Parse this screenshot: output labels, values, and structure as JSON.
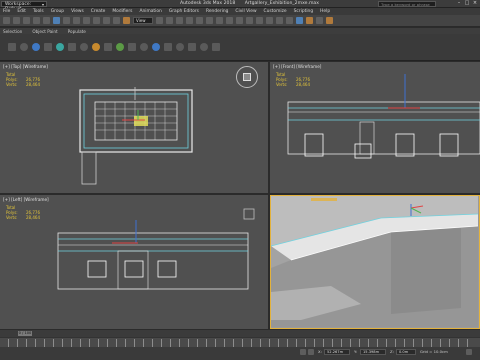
{
  "titlebar": {
    "workspace": "Workspace: Default",
    "app_title": "Autodesk 3ds Max 2018",
    "file_name": "Artgallery_Exhibition_2mxe.max",
    "search_placeholder": "Type a keyword or phrase"
  },
  "menu": [
    "File",
    "Edit",
    "Tools",
    "Group",
    "Views",
    "Create",
    "Modifiers",
    "Animation",
    "Graph Editors",
    "Rendering",
    "Civil View",
    "Customize",
    "Scripting",
    "Help"
  ],
  "toolbar": {
    "view_select": "View"
  },
  "ribbon": [
    "Selection",
    "Object Paint",
    "Populate"
  ],
  "viewports": {
    "top": {
      "label": "[+] [Top] [Wireframe]",
      "stats": {
        "title": "Total",
        "polys_label": "Polys:",
        "polys": "26,776",
        "verts_label": "Verts:",
        "verts": "28,464"
      }
    },
    "front": {
      "label": "[+] [Front] [Wireframe]",
      "stats": {
        "title": "Total",
        "polys_label": "Polys:",
        "polys": "26,776",
        "verts_label": "Verts:",
        "verts": "28,464"
      }
    },
    "left": {
      "label": "[+] [Left] [Wireframe]",
      "stats": {
        "title": "Total",
        "polys_label": "Polys:",
        "polys": "26,776",
        "verts_label": "Verts:",
        "verts": "28,464"
      }
    }
  },
  "timeline": {
    "frame": "0 / 100"
  },
  "status": {
    "x_label": "X:",
    "x_value": "52.267m",
    "y_label": "Y:",
    "y_value": "15.398m",
    "z_label": "Z:",
    "z_value": "0.0m",
    "grid": "Grid = 10.0cm"
  },
  "colors": {
    "accent": "#e3b23c",
    "stats": "#e2c43a",
    "viewport_bg": "#505050"
  }
}
